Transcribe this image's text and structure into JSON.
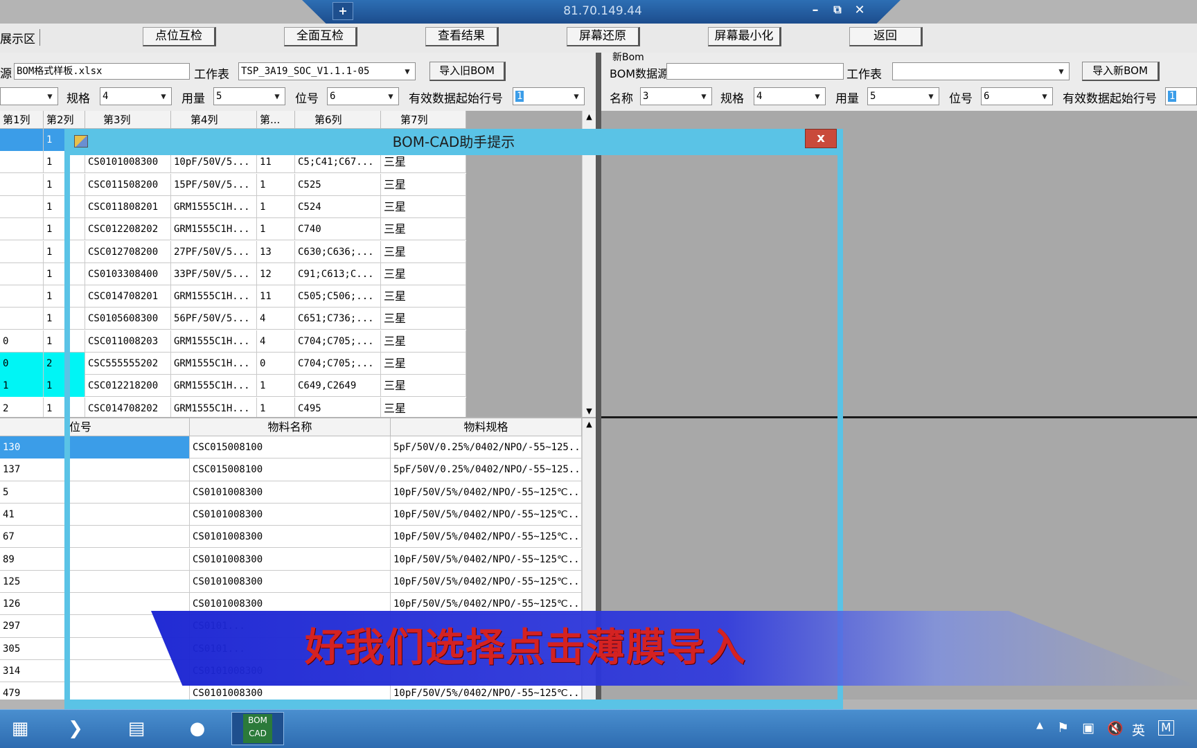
{
  "remote": {
    "title": "81.70.149.44",
    "pin": "+",
    "min": "–",
    "restore": "⧉",
    "close": "✕"
  },
  "toolbar": {
    "display_tab": "展示区",
    "buttons": [
      "点位互检",
      "全面互检",
      "查看结果",
      "屏幕还原",
      "屏幕最小化",
      "返回"
    ]
  },
  "left_panel": {
    "source_label": "源",
    "source_value": "BOM格式样板.xlsx",
    "sheet_label": "工作表",
    "sheet_value": "TSP_3A19_SOC_V1.1.1-05",
    "import_button": "导入旧BOM",
    "spec_label": "规格",
    "spec_value": "4",
    "qty_label": "用量",
    "qty_value": "5",
    "pos_label": "位号",
    "pos_value": "6",
    "start_label": "有效数据起始行号",
    "start_value": "1"
  },
  "right_panel": {
    "group_title": "新Bom",
    "source_label": "BOM数据源",
    "source_value": "",
    "sheet_label": "工作表",
    "sheet_value": "",
    "import_button": "导入新BOM",
    "name_label": "名称",
    "name_value": "3",
    "spec_label": "规格",
    "spec_value": "4",
    "qty_label": "用量",
    "qty_value": "5",
    "pos_label": "位号",
    "pos_value": "6",
    "start_label": "有效数据起始行号",
    "start_value": "1"
  },
  "top_grid": {
    "headers": [
      "第1列",
      "第2列",
      "第3列",
      "第4列",
      "第...",
      "第6列",
      "第7列"
    ],
    "rows": [
      {
        "c1": "",
        "c2": "1",
        "c3": "",
        "c4": "",
        "c5": "",
        "c6": "",
        "c7": ""
      },
      {
        "c1": "",
        "c2": "1",
        "c3": "CS0101008300",
        "c4": "10pF/50V/5...",
        "c5": "11",
        "c6": "C5;C41;C67...",
        "c7": "三星"
      },
      {
        "c1": "",
        "c2": "1",
        "c3": "CSC011508200",
        "c4": "15PF/50V/5...",
        "c5": "1",
        "c6": "C525",
        "c7": "三星"
      },
      {
        "c1": "",
        "c2": "1",
        "c3": "CSC011808201",
        "c4": "GRM1555C1H...",
        "c5": "1",
        "c6": "C524",
        "c7": "三星"
      },
      {
        "c1": "",
        "c2": "1",
        "c3": "CSC012208202",
        "c4": "GRM1555C1H...",
        "c5": "1",
        "c6": "C740",
        "c7": "三星"
      },
      {
        "c1": "",
        "c2": "1",
        "c3": "CSC012708200",
        "c4": "27PF/50V/5...",
        "c5": "13",
        "c6": "C630;C636;...",
        "c7": "三星"
      },
      {
        "c1": "",
        "c2": "1",
        "c3": "CS0103308400",
        "c4": "33PF/50V/5...",
        "c5": "12",
        "c6": "C91;C613;C...",
        "c7": "三星"
      },
      {
        "c1": "",
        "c2": "1",
        "c3": "CSC014708201",
        "c4": "GRM1555C1H...",
        "c5": "11",
        "c6": "C505;C506;...",
        "c7": "三星"
      },
      {
        "c1": "",
        "c2": "1",
        "c3": "CS0105608300",
        "c4": "56PF/50V/5...",
        "c5": "4",
        "c6": "C651;C736;...",
        "c7": "三星"
      },
      {
        "c1": "0",
        "c2": "1",
        "c3": "CSC011008203",
        "c4": "GRM1555C1H...",
        "c5": "4",
        "c6": "C704;C705;...",
        "c7": "三星"
      },
      {
        "c1": "0",
        "c2": "2",
        "c3": "CSC555555202",
        "c4": "GRM1555C1H...",
        "c5": "0",
        "c6": "C704;C705;...",
        "c7": "三星"
      },
      {
        "c1": "1",
        "c2": "1",
        "c3": "CSC012218200",
        "c4": "GRM1555C1H...",
        "c5": "1",
        "c6": "C649,C2649",
        "c7": "三星"
      },
      {
        "c1": "2",
        "c2": "1",
        "c3": "CSC014708202",
        "c4": "GRM1555C1H...",
        "c5": "1",
        "c6": "C495",
        "c7": "三星"
      }
    ]
  },
  "bottom_grid": {
    "headers": [
      "位号",
      "物料名称",
      "物料规格"
    ],
    "rows": [
      {
        "pos": "130",
        "name": "CSC015008100",
        "spec": "5pF/50V/0.25%/0402/NPO/-55~125..."
      },
      {
        "pos": "137",
        "name": "CSC015008100",
        "spec": "5pF/50V/0.25%/0402/NPO/-55~125..."
      },
      {
        "pos": "5",
        "name": "CS0101008300",
        "spec": "10pF/50V/5%/0402/NPO/-55~125℃..."
      },
      {
        "pos": "41",
        "name": "CS0101008300",
        "spec": "10pF/50V/5%/0402/NPO/-55~125℃..."
      },
      {
        "pos": "67",
        "name": "CS0101008300",
        "spec": "10pF/50V/5%/0402/NPO/-55~125℃..."
      },
      {
        "pos": "89",
        "name": "CS0101008300",
        "spec": "10pF/50V/5%/0402/NPO/-55~125℃..."
      },
      {
        "pos": "125",
        "name": "CS0101008300",
        "spec": "10pF/50V/5%/0402/NPO/-55~125℃..."
      },
      {
        "pos": "126",
        "name": "CS0101008300",
        "spec": "10pF/50V/5%/0402/NPO/-55~125℃..."
      },
      {
        "pos": "297",
        "name": "CS0101...",
        "spec": ""
      },
      {
        "pos": "305",
        "name": "CS0101...",
        "spec": ""
      },
      {
        "pos": "314",
        "name": "CS0101008300",
        "spec": ""
      },
      {
        "pos": "479",
        "name": "CS0101008300",
        "spec": "10pF/50V/5%/0402/NPO/-55~125℃..."
      }
    ]
  },
  "dialog": {
    "title": "BOM-CAD助手提示",
    "close": "x"
  },
  "subtitle": "好我们选择点击薄膜导入",
  "taskbar": {
    "app_label": "BOM CAD",
    "tray_lang": "英",
    "tray_m": "M"
  },
  "colors": {
    "accent": "#5ac3e6",
    "selected_row": "#3b9de8",
    "highlight": "#00f5f5",
    "subtitle": "#d42222"
  }
}
